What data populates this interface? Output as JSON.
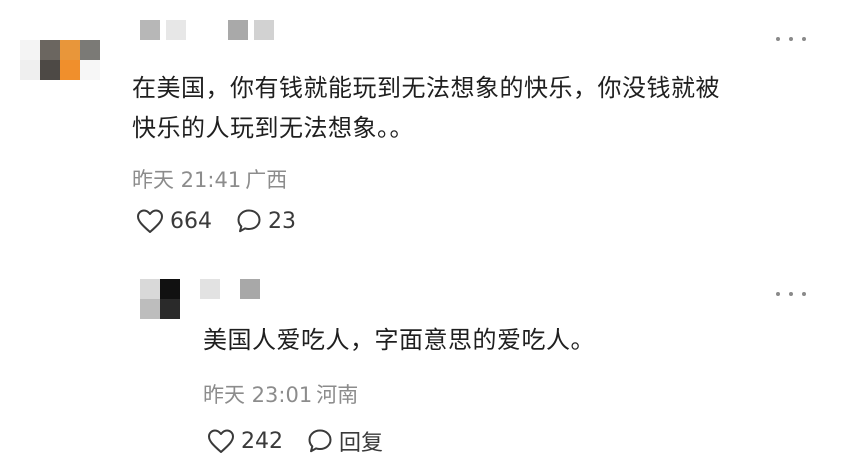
{
  "comments": [
    {
      "text_line1": "在美国，你有钱就能玩到无法想象的快乐，你没钱就被",
      "text_line2": "快乐的人玩到无法想象。。",
      "time": "昨天 21:41",
      "location": "广西",
      "likes": "664",
      "replies": "23"
    },
    {
      "text_line1": "美国人爱吃人，字面意思的爱吃人。",
      "time": "昨天 23:01",
      "location": "河南",
      "likes": "242",
      "reply_label": "回复"
    }
  ],
  "icons": {
    "like": "heart-outline-icon",
    "comment": "speech-bubble-icon",
    "more": "more-dots-icon"
  },
  "colors": {
    "text": "#1f1f1f",
    "meta": "#8c8c8c",
    "icon": "#3a3a3a"
  }
}
